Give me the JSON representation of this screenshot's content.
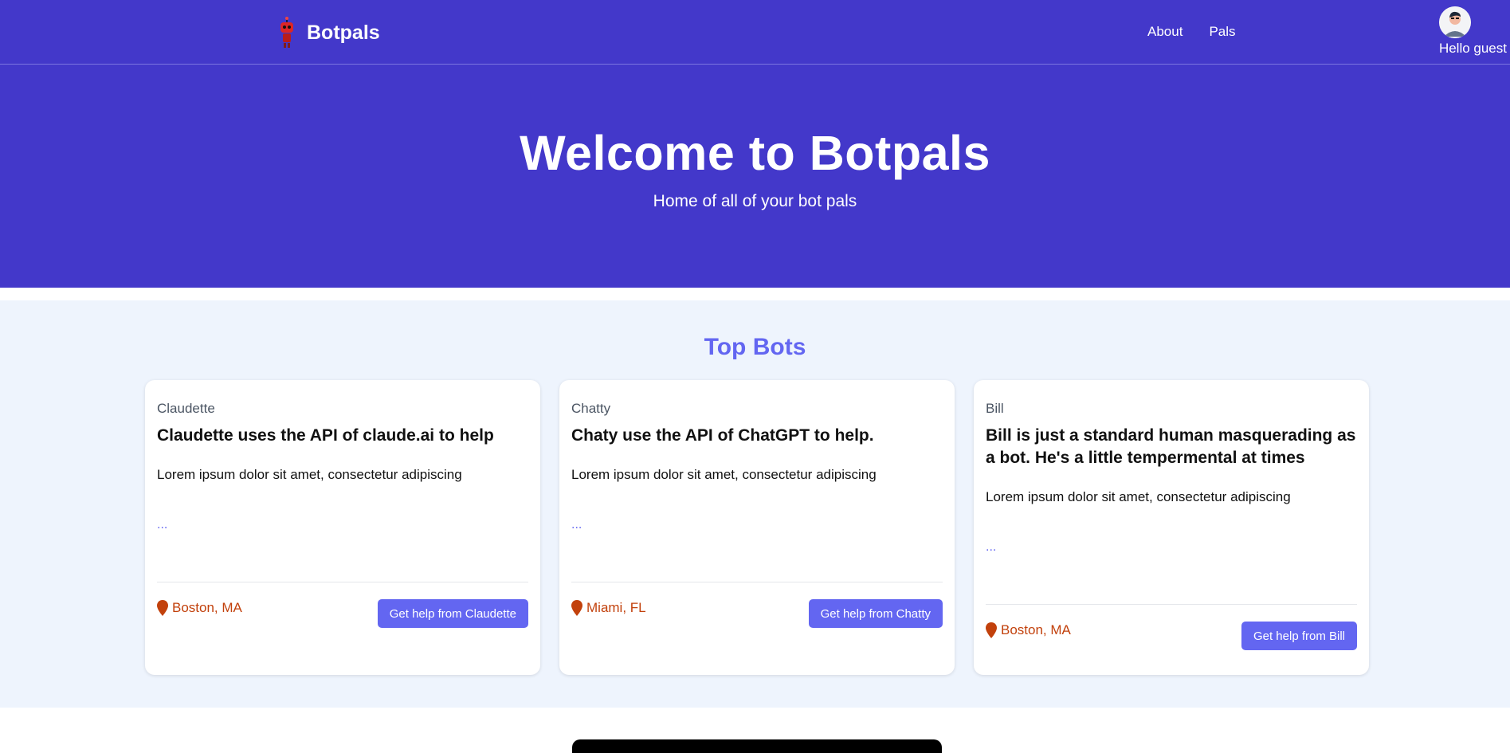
{
  "header": {
    "brand": "Botpals",
    "nav": [
      "About",
      "Pals"
    ],
    "greeting": "Hello guest"
  },
  "hero": {
    "title": "Welcome to Botpals",
    "subtitle": "Home of all of your bot pals"
  },
  "top_bots": {
    "title": "Top Bots",
    "cards": [
      {
        "name": "Claudette",
        "headline": "Claudette uses the API of claude.ai to help",
        "description": "Lorem ipsum dolor sit amet, consectetur adipiscing",
        "more": "...",
        "location": "Boston, MA",
        "button": "Get help from Claudette"
      },
      {
        "name": "Chatty",
        "headline": "Chaty use the API of ChatGPT to help.",
        "description": "Lorem ipsum dolor sit amet, consectetur adipiscing",
        "more": "...",
        "location": "Miami, FL",
        "button": "Get help from Chatty"
      },
      {
        "name": "Bill",
        "headline": "Bill is just a standard human masquerading as a bot. He's a little tempermental at times",
        "description": "Lorem ipsum dolor sit amet, consectetur adipiscing",
        "more": "...",
        "location": "Boston, MA",
        "button": "Get help from Bill"
      }
    ]
  },
  "colors": {
    "primary": "#4338ca",
    "accent": "#6366f1",
    "location": "#c2410c",
    "section_bg": "#eef4fd"
  },
  "icons": [
    "robot-logo-icon",
    "user-avatar-icon",
    "map-pin-icon"
  ]
}
